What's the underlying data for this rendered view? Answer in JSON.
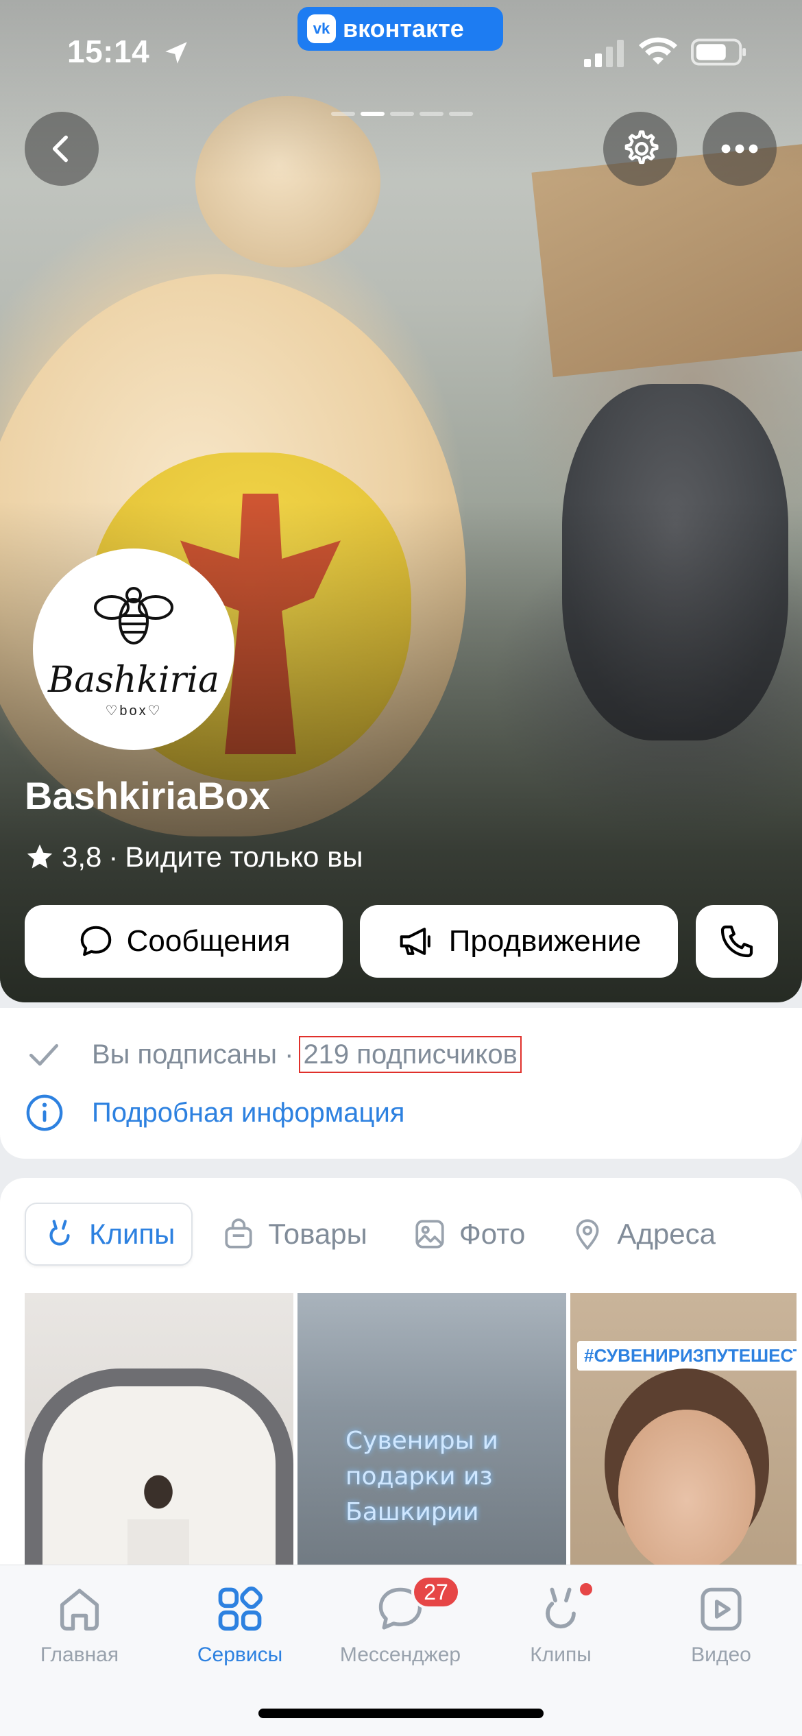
{
  "status": {
    "time": "15:14",
    "app_pill": "вконтакте",
    "app_pill_logo": "vk"
  },
  "header": {
    "story_pages": 5,
    "story_active_index": 1
  },
  "group": {
    "name": "BashkiriaBox",
    "avatar_word": "Bashkiria",
    "avatar_sub": "♡box♡",
    "rating": "3,8",
    "separator": "·",
    "visibility": "Видите только вы"
  },
  "actions": {
    "messages": "Сообщения",
    "promotion": "Продвижение"
  },
  "info": {
    "subscribed": "Вы подписаны ·",
    "subscribers": "219 подписчиков",
    "details": "Подробная информация"
  },
  "tabs": [
    {
      "label": "Клипы",
      "icon": "clip-icon",
      "active": true
    },
    {
      "label": "Товары",
      "icon": "bag-icon",
      "active": false
    },
    {
      "label": "Фото",
      "icon": "photo-icon",
      "active": false
    },
    {
      "label": "Адреса",
      "icon": "location-pin-icon",
      "active": false
    }
  ],
  "clips": {
    "clip2_text": "Сувениры и подарки из Башкирии",
    "clip3_tag": "#СУВЕНИРИЗПУТЕШЕСТВ"
  },
  "tabbar": {
    "home": "Главная",
    "services": "Сервисы",
    "messenger": "Мессенджер",
    "messenger_badge": "27",
    "clips": "Клипы",
    "video": "Видео"
  },
  "colors": {
    "accent": "#2d81e0",
    "vk_blue": "#1d7cf2",
    "badge_red": "#e64646",
    "highlight_border": "#e0302b"
  }
}
